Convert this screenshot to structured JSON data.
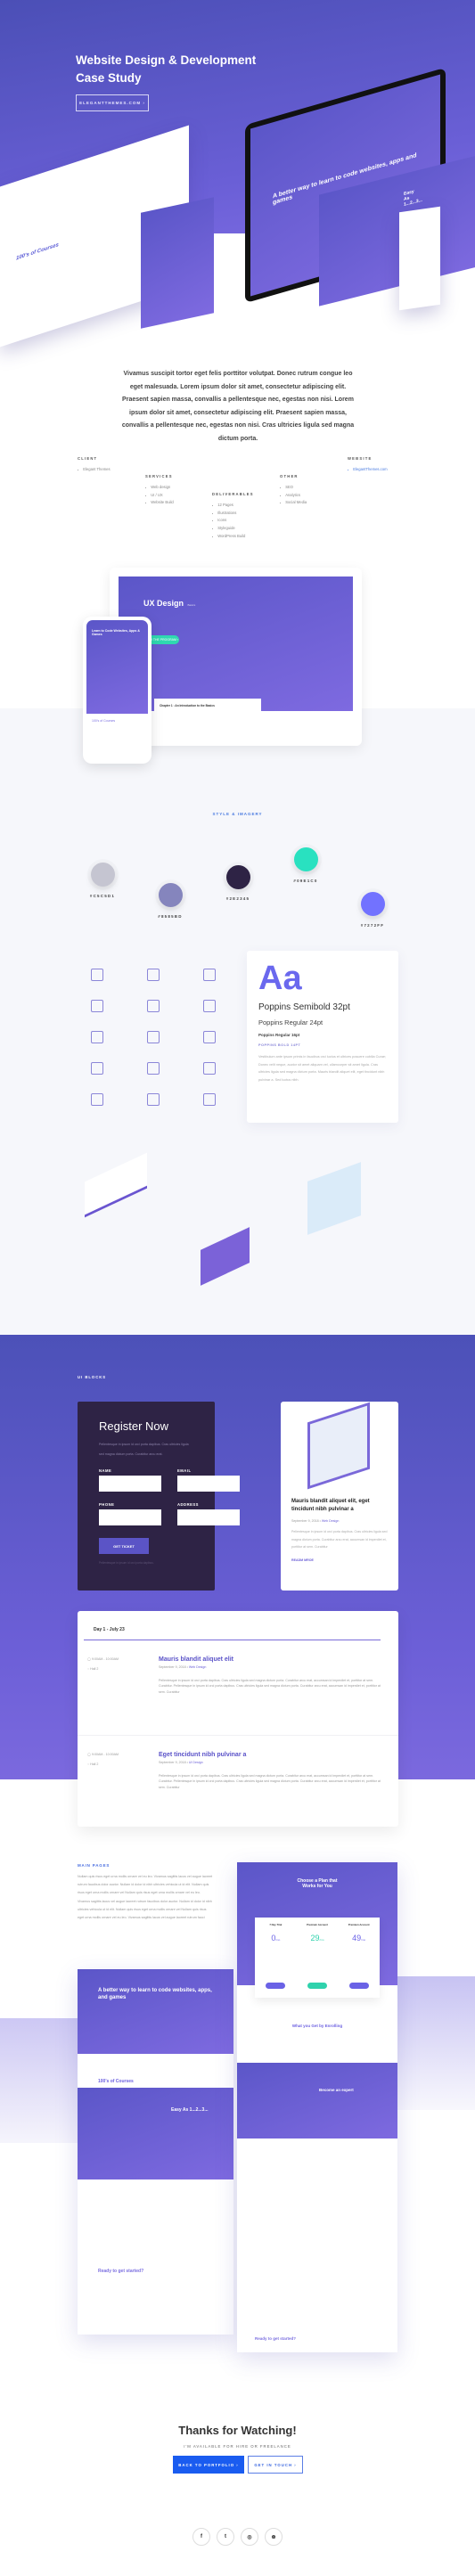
{
  "hero": {
    "title_line1": "Website Design & Development",
    "title_line2": "Case Study",
    "button": "ELEGANTTHEMES.COM ›",
    "mockups": {
      "courses_title": "100's of Courses",
      "monitor_headline": "A better way to learn to code websites, apps and games",
      "tablet_title": "Easy As 1...2...3..."
    }
  },
  "intro": "Vivamus suscipit tortor eget felis porttitor volutpat. Donec rutrum congue leo eget malesuada. Lorem ipsum dolor sit amet, consectetur adipiscing elit. Praesent sapien massa, convallis a pellentesque nec, egestas non nisi. Lorem ipsum dolor sit amet, consectetur adipiscing elit. Praesent sapien massa, convallis a pellentesque nec, egestas non nisi. Cras ultricies ligula sed magna dictum porta.",
  "info": {
    "client": {
      "heading": "CLIENT",
      "items": [
        "Elegant Themes"
      ]
    },
    "services": {
      "heading": "SERVICES",
      "items": [
        "Web design",
        "UI / UX",
        "Website Build"
      ]
    },
    "deliverables": {
      "heading": "DELIVERABLES",
      "items": [
        "12 Pages",
        "Illustrations",
        "Icons",
        "Styleguide",
        "WordPress Build"
      ]
    },
    "other": {
      "heading": "OTHER",
      "items": [
        "SEO",
        "Analytics",
        "Social Media"
      ]
    },
    "website": {
      "heading": "WEBSITE",
      "items": [
        "ElegantThemes.com"
      ]
    }
  },
  "devices": {
    "laptop_title": "UX Design",
    "laptop_subtitle": "Basics",
    "laptop_button": "VIEW THE PROGRAM ›",
    "chapter": "Chapter 1 : An Introduction to the Basics",
    "phone_title": "Learn to Code Websites, Apps & Games",
    "phone_courses": "100's of Courses"
  },
  "style": {
    "label": "STYLE & IMAGERY",
    "swatches": [
      {
        "hex": "#C5C5D1",
        "label": "#C5C5D1"
      },
      {
        "hex": "#8585BD",
        "label": "#8585BD"
      },
      {
        "hex": "#2E2345",
        "label": "#2E2345"
      },
      {
        "hex": "#29E1C0",
        "label": "#09E1C0"
      },
      {
        "hex": "#7272FF",
        "label": "#7272FF"
      }
    ],
    "icons": [
      "code-window",
      "document-chart",
      "video-play",
      "lightbulb-screen",
      "layout-grid",
      "devices",
      "python",
      "documents",
      "mobile-tablet",
      "list-document",
      "bar-chart",
      "touch-screen",
      "robot",
      "chip",
      "monitor"
    ],
    "typography": {
      "sample": "Aa",
      "h1": "Poppins Semibold 32pt",
      "h2": "Poppins Regular 24pt",
      "h3": "Poppins Regular 16pt",
      "h4": "POPPINS BOLD 14PT",
      "body": "Vestibulum ante ipsum primis in faucibus orci luctus et ultrices posuere cubilia Curae; Donec velit neque, auctor sit amet aliquam vel, ullamcorper sit amet ligula. Cras ultricies ligula sed magna dictum porta. Mauris blandit aliquet elit, eget tincidunt nibh pulvinar a. Sed luctus nibh."
    }
  },
  "ui_blocks": {
    "label": "UI BLOCKS",
    "register": {
      "title": "Register Now",
      "desc": "Pellentesque in ipsum id orci porta dapibus. Cras ultricies ligula sed magna dictum porta. Curabitur arcu erat.",
      "name": "NAME",
      "email": "EMAIL",
      "phone": "PHONE",
      "address": "ADDRESS",
      "button": "GET TICKET",
      "note": "Pellentesque in ipsum id orci porta dapibus."
    },
    "blog": {
      "title": "Mauris blandit aliquet elit, eget tincidunt nibh pulvinar a",
      "date": "September 9, 2018 •",
      "category": "Web Design",
      "excerpt": "Pellentesque in ipsum id orci porta dapibus. Cras ultricies ligula sed magna dictum porta. Curabitur arcu erat, accumsan id imperdiet et, porttitor at sem. Curabitur",
      "more": "READM MROE"
    },
    "schedule": {
      "day": "Day 1 - July 23",
      "events": [
        {
          "time": "9:00AM - 10:00AM",
          "location": "Hall 2",
          "title": "Mauris blandit aliquet elit",
          "date": "September 9, 2018 •",
          "category": "Web Design",
          "text": "Pellentesque in ipsum id orci porta dapibus. Cras ultricies ligula sed magna dictum porta. Curabitur arcu erat, accumsan id imperdiet et, porttitor at sem. Curabitur. Pellentesque in ipsum id orci porta dapibus. Cras ultricies ligula sed magna dictum porta. Curabitur arcu erat, accumsan id imperdiet et, porttitor at sem. Curabitur"
        },
        {
          "time": "9:00AM - 10:00AM",
          "location": "Hall 2",
          "title": "Eget tincidunt nibh pulvinar a",
          "date": "September 9, 2018 •",
          "category": "UI Design",
          "text": "Pellentesque in ipsum id orci porta dapibus. Cras ultricies ligula sed magna dictum porta. Curabitur arcu erat, accumsan id imperdiet et, porttitor at sem. Curabitur. Pellentesque in ipsum id orci porta dapibus. Cras ultricies ligula sed magna dictum porta. Curabitur arcu erat, accumsan id imperdiet et, porttitor at sem. Curabitur"
        }
      ]
    }
  },
  "main_pages": {
    "label": "MAIN PAGES",
    "text": "Nullam quis risus eget urna mollis ornare vel eu leo. Vivamus sagittis lacus vel augue laoreet rutrum faucibus dolor auctor. Nullam id dolor id nibh ultricies vehicula ut id elit. Nullam quis risus eget urna mollis ornare vel Nullam quis risus eget urna mollis ornare vel eu leo. Vivamus sagittis lacus vel augue laoreet rutrum faucibus dolor auctor. Nullam id dolor id nibh ultricies vehicula ut id elit. Nullam quis risus eget urna mollis ornare vel Nullam quis risus eget urna mollis ornare vel eu leo. Vivamus sagittis lacus vel augue laoreet rutrum fauci",
    "pricing": {
      "title": "Choose a Plan that Works for You",
      "plans": [
        {
          "name": "7 Day Trial",
          "price": "0",
          "per": "/mo"
        },
        {
          "name": "Premium Account",
          "price": "29",
          "per": "/mo"
        },
        {
          "name": "Premium Account",
          "price": "49",
          "per": "/mo"
        }
      ],
      "enrolling": "What you Get by Enrolling",
      "expert": "Become an expert",
      "ready": "Ready to get started?"
    },
    "home": {
      "headline": "A better way to learn to code websites, apps, and games",
      "courses": "100's of Courses",
      "easy": "Easy As 1...2...3...",
      "ready": "Ready to get started?"
    }
  },
  "footer": {
    "title": "Thanks for Watching!",
    "subtitle": "I'M AVAILABLE FOR HIRE OR FREELANCE",
    "back": "BACK TO PORTFOLIO ›",
    "touch": "GET IN TOUCH ›",
    "social": [
      "f",
      "t",
      "◎",
      "⊛"
    ]
  }
}
